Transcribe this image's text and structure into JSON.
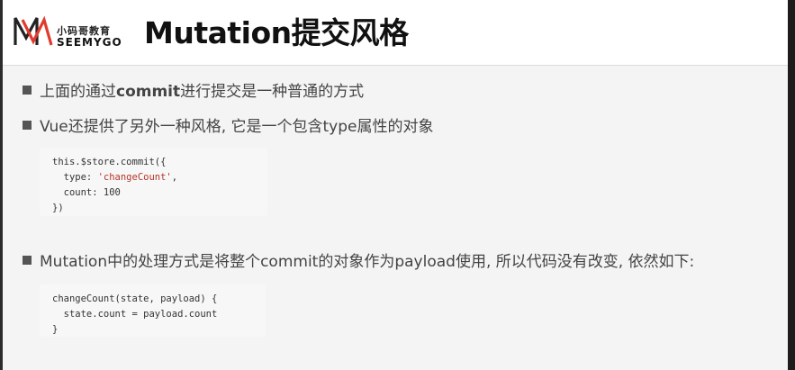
{
  "logo": {
    "icon": "seemygo-m-logo-icon",
    "brand_cn": "小码哥教育",
    "brand_en": "SEEMYGO",
    "colors": {
      "outline": "#222222",
      "accent": "#e23b2e"
    }
  },
  "title": "Mutation提交风格",
  "bullets": [
    {
      "before": "上面的通过",
      "bold": "commit",
      "after": "进行提交是一种普通的方式"
    },
    {
      "text": "Vue还提供了另外一种风格, 它是一个包含type属性的对象"
    },
    {
      "text": "Mutation中的处理方式是将整个commit的对象作为payload使用, 所以代码没有改变, 依然如下:"
    }
  ],
  "code_blocks": [
    {
      "lines": [
        {
          "code": "this.$store.commit({"
        },
        {
          "prefix": "  type: ",
          "string": "'changeCount'",
          "suffix": ","
        },
        {
          "code": "  count: 100"
        },
        {
          "code": "})"
        }
      ]
    },
    {
      "lines": [
        {
          "code": "changeCount(state, payload) {"
        },
        {
          "code": "  state.count = payload.count"
        },
        {
          "code": "}"
        }
      ]
    }
  ],
  "colors": {
    "code_string": "#b5362c",
    "bullet_mark": "#555555",
    "content_background": "#f4f4f4"
  }
}
